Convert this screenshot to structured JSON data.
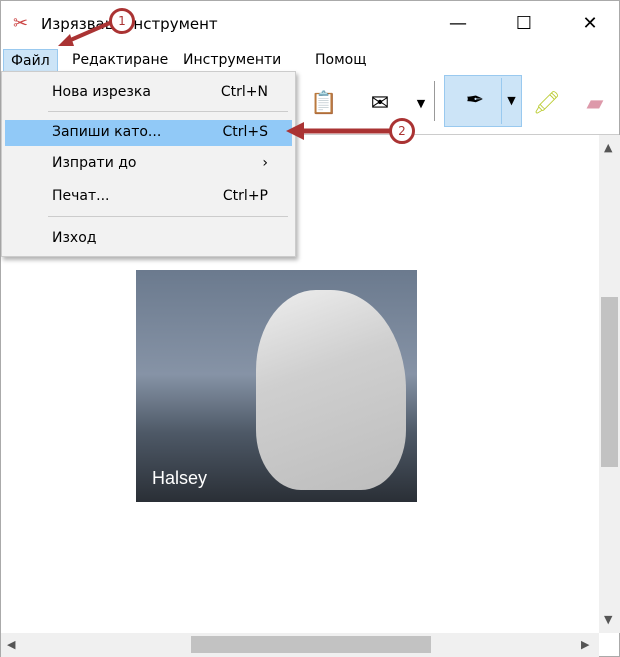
{
  "window": {
    "title": "Изрязващ инструмент",
    "minimize": "—",
    "maximize": "☐",
    "close": "✕"
  },
  "menubar": [
    "Файл",
    "Редактиране",
    "Инструменти",
    "Помощ"
  ],
  "file_menu": [
    {
      "label": "Нова изрезка",
      "shortcut": "Ctrl+N"
    },
    {
      "label": "Запиши като...",
      "shortcut": "Ctrl+S",
      "highlighted": true
    },
    {
      "label": "Изпрати до",
      "shortcut": "›"
    },
    {
      "label": "Печат...",
      "shortcut": "Ctrl+P"
    },
    {
      "label": "Изход",
      "shortcut": ""
    }
  ],
  "toolbar": {
    "icons": [
      "copy-icon",
      "send-email-icon",
      "pen-icon",
      "highlighter-icon",
      "eraser-icon"
    ]
  },
  "content": {
    "caption": "Halsey"
  },
  "annotations": {
    "step1": "1",
    "step2": "2",
    "color": "#a33333"
  }
}
